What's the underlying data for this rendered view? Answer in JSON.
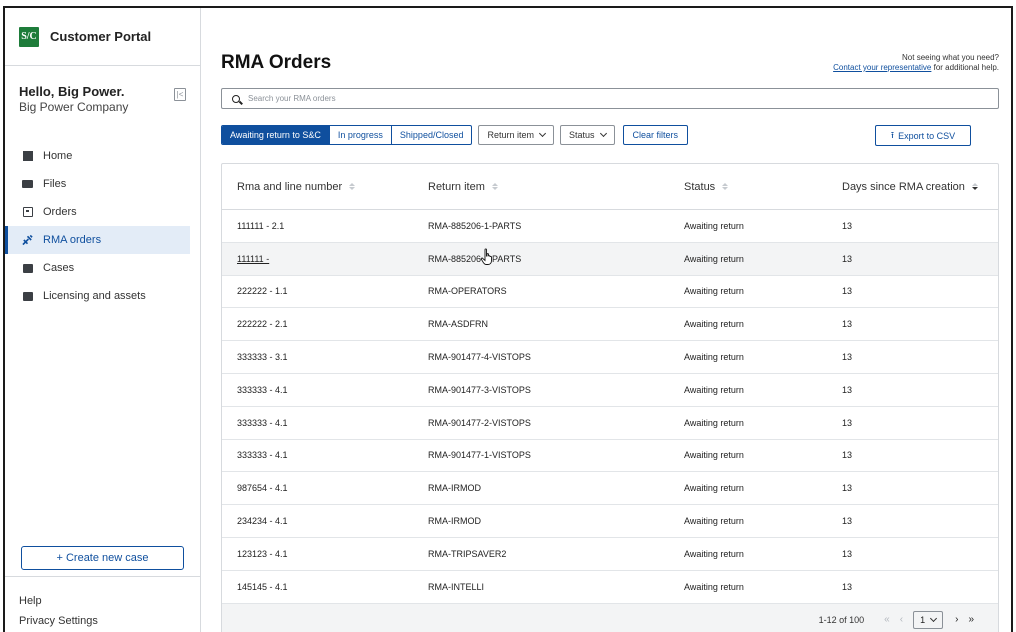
{
  "brand": {
    "title": "Customer Portal",
    "logo_text": "S/C"
  },
  "greeting": {
    "hello": "Hello, Big Power.",
    "company": "Big Power Company"
  },
  "nav": {
    "items": [
      {
        "label": "Home",
        "icon": "home-icon"
      },
      {
        "label": "Files",
        "icon": "folder-icon"
      },
      {
        "label": "Orders",
        "icon": "orders-icon"
      },
      {
        "label": "RMA orders",
        "icon": "wrench-icon",
        "active": true
      },
      {
        "label": "Cases",
        "icon": "briefcase-icon"
      },
      {
        "label": "Licensing and assets",
        "icon": "license-icon"
      }
    ]
  },
  "sidebar_footer": {
    "create_label": "+ Create new case",
    "help": "Help",
    "privacy": "Privacy Settings"
  },
  "page": {
    "title": "RMA Orders",
    "help_line1": "Not seeing what you need?",
    "help_link": "Contact your representative",
    "help_line2": " for additional help."
  },
  "search": {
    "placeholder": "Search your RMA orders"
  },
  "filters": {
    "tabs": [
      "Awaiting return to S&C",
      "In progress",
      "Shipped/Closed"
    ],
    "return_item": "Return item",
    "status": "Status",
    "clear": "Clear filters",
    "export": "Export to CSV"
  },
  "table": {
    "columns": [
      "Rma and line number",
      "Return item",
      "Status",
      "Days since RMA creation"
    ],
    "rows": [
      {
        "rma": "111111 - 2.1",
        "item": "RMA-885206-1-PARTS",
        "status": "Awaiting return",
        "days": "13"
      },
      {
        "rma": "111111 -",
        "item": "RMA-885206-2-PARTS",
        "status": "Awaiting return",
        "days": "13"
      },
      {
        "rma": "222222 - 1.1",
        "item": "RMA-OPERATORS",
        "status": "Awaiting return",
        "days": "13"
      },
      {
        "rma": "222222 - 2.1",
        "item": "RMA-ASDFRN",
        "status": "Awaiting return",
        "days": "13"
      },
      {
        "rma": "333333 - 3.1",
        "item": "RMA-901477-4-VISTOPS",
        "status": "Awaiting return",
        "days": "13"
      },
      {
        "rma": "333333 - 4.1",
        "item": "RMA-901477-3-VISTOPS",
        "status": "Awaiting return",
        "days": "13"
      },
      {
        "rma": "333333 - 4.1",
        "item": "RMA-901477-2-VISTOPS",
        "status": "Awaiting return",
        "days": "13"
      },
      {
        "rma": "333333 - 4.1",
        "item": "RMA-901477-1-VISTOPS",
        "status": "Awaiting return",
        "days": "13"
      },
      {
        "rma": "987654 - 4.1",
        "item": "RMA-IRMOD",
        "status": "Awaiting return",
        "days": "13"
      },
      {
        "rma": "234234 - 4.1",
        "item": "RMA-IRMOD",
        "status": "Awaiting return",
        "days": "13"
      },
      {
        "rma": "123123 - 4.1",
        "item": "RMA-TRIPSAVER2",
        "status": "Awaiting return",
        "days": "13"
      },
      {
        "rma": "145145 - 4.1",
        "item": "RMA-INTELLI",
        "status": "Awaiting return",
        "days": "13"
      }
    ]
  },
  "pagination": {
    "range": "1-12 of 100",
    "page": "1",
    "first": "«",
    "prev": "‹",
    "next": "›",
    "last": "»"
  }
}
